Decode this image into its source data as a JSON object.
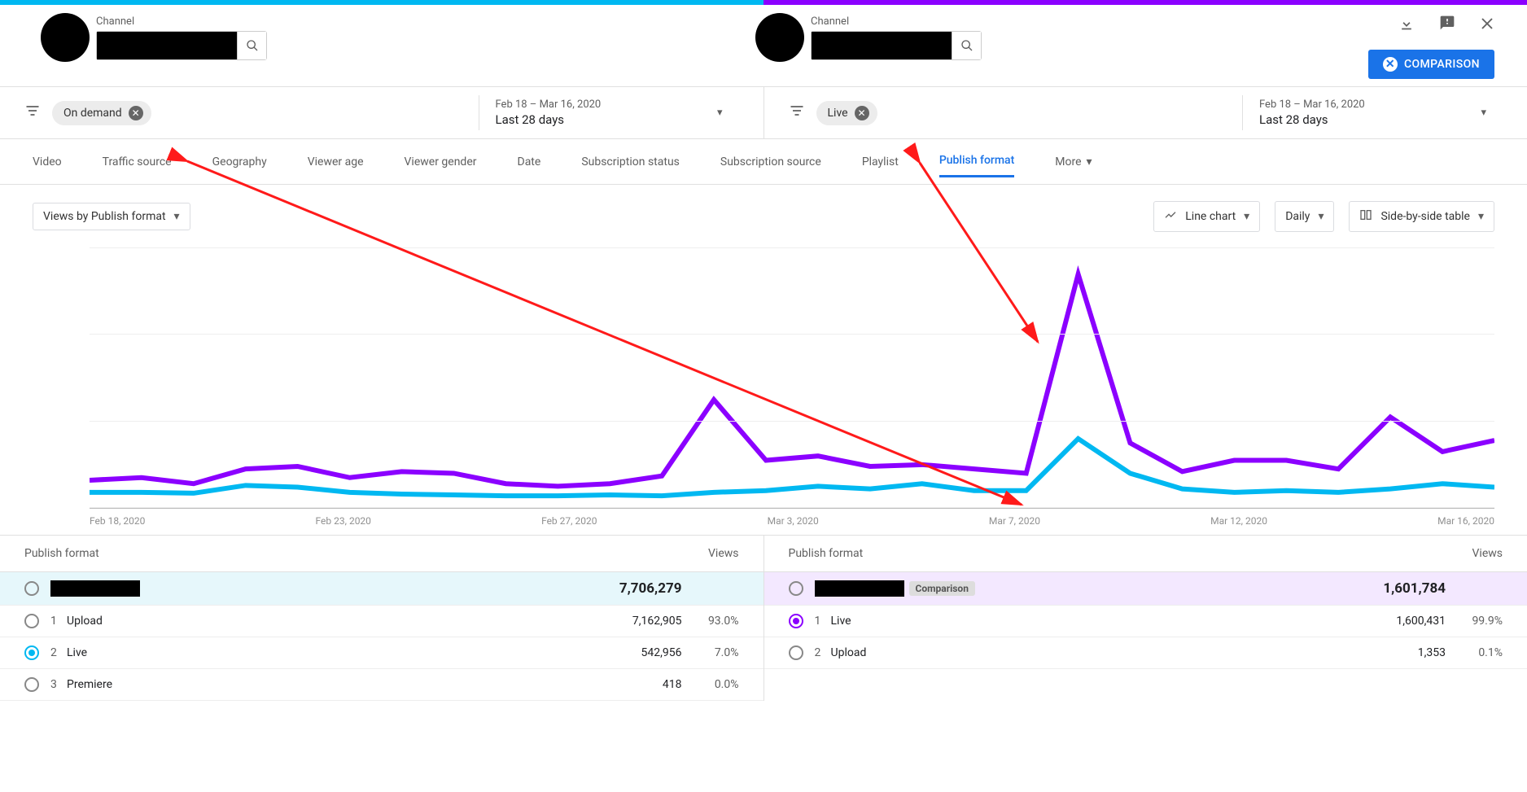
{
  "colors": {
    "left": "#00b8f1",
    "right": "#8b00ff",
    "accent": "#1a73e8"
  },
  "header": {
    "channel_label": "Channel",
    "download_icon": "⬇",
    "feedback_icon": "▮",
    "close_icon": "✕",
    "comparison_button": "COMPARISON"
  },
  "filters": {
    "left_chip": "On demand",
    "right_chip": "Live",
    "date_range": "Feb 18 – Mar 16, 2020",
    "date_label": "Last 28 days"
  },
  "tabs": [
    "Video",
    "Traffic source",
    "Geography",
    "Viewer age",
    "Viewer gender",
    "Date",
    "Subscription status",
    "Subscription source",
    "Playlist",
    "Publish format"
  ],
  "tabs_more": "More",
  "tabs_active_index": 9,
  "controls": {
    "metric": "Views by Publish format",
    "chart_type": "Line chart",
    "granularity": "Daily",
    "table_mode": "Side-by-side table"
  },
  "chart_data": {
    "type": "line",
    "ylabel": "",
    "ylim": [
      0,
      300000
    ],
    "yticks": [
      "0",
      "100.0K",
      "200.0K",
      "300.0K"
    ],
    "x_labels": [
      "Feb 18, 2020",
      "Feb 23, 2020",
      "Feb 27, 2020",
      "Mar 3, 2020",
      "Mar 7, 2020",
      "Mar 12, 2020",
      "Mar 16, 2020"
    ],
    "x_days": [
      "Feb 18",
      "Feb 19",
      "Feb 20",
      "Feb 21",
      "Feb 22",
      "Feb 23",
      "Feb 24",
      "Feb 25",
      "Feb 26",
      "Feb 27",
      "Feb 28",
      "Feb 29",
      "Mar 1",
      "Mar 2",
      "Mar 3",
      "Mar 4",
      "Mar 5",
      "Mar 6",
      "Mar 7",
      "Mar 8",
      "Mar 9",
      "Mar 10",
      "Mar 11",
      "Mar 12",
      "Mar 13",
      "Mar 14",
      "Mar 15",
      "Mar 16"
    ],
    "series": [
      {
        "name": "Live (Comparison)",
        "color": "#8b00ff",
        "values": [
          32000,
          35000,
          28000,
          45000,
          48000,
          35000,
          42000,
          40000,
          28000,
          25000,
          28000,
          37000,
          125000,
          55000,
          60000,
          48000,
          50000,
          45000,
          40000,
          270000,
          75000,
          42000,
          55000,
          55000,
          45000,
          105000,
          65000,
          78000
        ]
      },
      {
        "name": "On demand",
        "color": "#00b8f1",
        "values": [
          18000,
          18000,
          17000,
          26000,
          24000,
          18000,
          16000,
          15000,
          14000,
          14000,
          15000,
          14000,
          18000,
          20000,
          25000,
          22000,
          28000,
          20000,
          20000,
          80000,
          40000,
          22000,
          18000,
          20000,
          18000,
          22000,
          28000,
          24000
        ]
      }
    ]
  },
  "tables": {
    "left": {
      "header_label": "Publish format",
      "header_metric": "Views",
      "total": "7,706,279",
      "rows": [
        {
          "rank": "1",
          "label": "Upload",
          "value": "7,162,905",
          "pct": "93.0%"
        },
        {
          "rank": "2",
          "label": "Live",
          "value": "542,956",
          "pct": "7.0%"
        },
        {
          "rank": "3",
          "label": "Premiere",
          "value": "418",
          "pct": "0.0%"
        }
      ]
    },
    "right": {
      "header_label": "Publish format",
      "header_metric": "Views",
      "total_badge": "Comparison",
      "total": "1,601,784",
      "rows": [
        {
          "rank": "1",
          "label": "Live",
          "value": "1,600,431",
          "pct": "99.9%"
        },
        {
          "rank": "2",
          "label": "Upload",
          "value": "1,353",
          "pct": "0.1%"
        }
      ]
    }
  }
}
